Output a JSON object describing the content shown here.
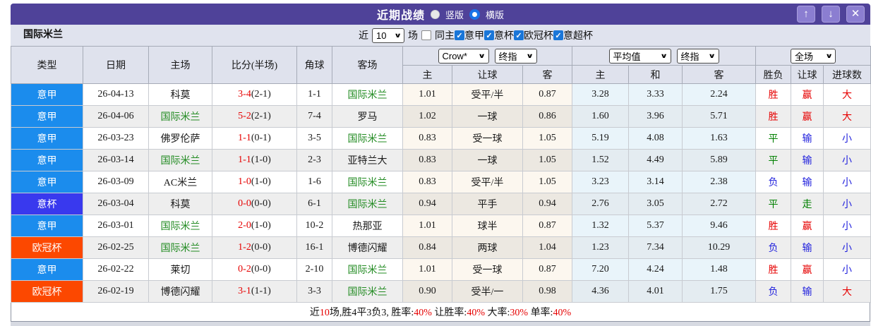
{
  "title_bar": {
    "title": "近期战绩",
    "vertical_label": "竖版",
    "horizontal_label": "横版",
    "up_icon": "↑",
    "down_icon": "↓",
    "close_icon": "✕"
  },
  "filter_bar": {
    "team": "国际米兰",
    "recent_label": "近",
    "recent_value": "10",
    "matches_label": "场",
    "same_host_label": "同主",
    "leagues": [
      {
        "label": "意甲",
        "checked": true
      },
      {
        "label": "意杯",
        "checked": true
      },
      {
        "label": "欧冠杯",
        "checked": true
      },
      {
        "label": "意超杯",
        "checked": true
      }
    ]
  },
  "table": {
    "headers": {
      "static": [
        "类型",
        "日期",
        "主场",
        "比分(半场)",
        "角球",
        "客场"
      ],
      "sub": [
        "主",
        "让球",
        "客",
        "主",
        "和",
        "客",
        "胜负",
        "让球",
        "进球数"
      ],
      "group1_select1": "Crow*",
      "group1_select2": "终指",
      "group2_select1": "平均值",
      "group2_select2": "终指",
      "group3_select1": "全场"
    },
    "rows": [
      {
        "league": "意甲",
        "league_class": "lg-seriea",
        "date": "26-04-13",
        "home": "科莫",
        "home_green": false,
        "score": "3-4",
        "half": "(2-1)",
        "corners": "1-1",
        "away": "国际米兰",
        "away_green": true,
        "crow_home": "1.01",
        "handicap": "受平/半",
        "crow_away": "0.87",
        "avg_home": "3.28",
        "avg_draw": "3.33",
        "avg_away": "2.24",
        "result": "胜",
        "result_class": "c-red",
        "handicap_result": "赢",
        "handicap_class": "c-red",
        "goals": "大",
        "goals_class": "c-red"
      },
      {
        "league": "意甲",
        "league_class": "lg-seriea",
        "date": "26-04-06",
        "home": "国际米兰",
        "home_green": true,
        "score": "5-2",
        "half": "(2-1)",
        "corners": "7-4",
        "away": "罗马",
        "away_green": false,
        "crow_home": "1.02",
        "handicap": "一球",
        "crow_away": "0.86",
        "avg_home": "1.60",
        "avg_draw": "3.96",
        "avg_away": "5.71",
        "result": "胜",
        "result_class": "c-red",
        "handicap_result": "赢",
        "handicap_class": "c-red",
        "goals": "大",
        "goals_class": "c-red"
      },
      {
        "league": "意甲",
        "league_class": "lg-seriea",
        "date": "26-03-23",
        "home": "佛罗伦萨",
        "home_green": false,
        "score": "1-1",
        "half": "(0-1)",
        "corners": "3-5",
        "away": "国际米兰",
        "away_green": true,
        "crow_home": "0.83",
        "handicap": "受一球",
        "crow_away": "1.05",
        "avg_home": "5.19",
        "avg_draw": "4.08",
        "avg_away": "1.63",
        "result": "平",
        "result_class": "c-green",
        "handicap_result": "输",
        "handicap_class": "c-blue",
        "goals": "小",
        "goals_class": "c-blue"
      },
      {
        "league": "意甲",
        "league_class": "lg-seriea",
        "date": "26-03-14",
        "home": "国际米兰",
        "home_green": true,
        "score": "1-1",
        "half": "(1-0)",
        "corners": "2-3",
        "away": "亚特兰大",
        "away_green": false,
        "crow_home": "0.83",
        "handicap": "一球",
        "crow_away": "1.05",
        "avg_home": "1.52",
        "avg_draw": "4.49",
        "avg_away": "5.89",
        "result": "平",
        "result_class": "c-green",
        "handicap_result": "输",
        "handicap_class": "c-blue",
        "goals": "小",
        "goals_class": "c-blue"
      },
      {
        "league": "意甲",
        "league_class": "lg-seriea",
        "date": "26-03-09",
        "home": "AC米兰",
        "home_green": false,
        "score": "1-0",
        "half": "(1-0)",
        "corners": "1-6",
        "away": "国际米兰",
        "away_green": true,
        "crow_home": "0.83",
        "handicap": "受平/半",
        "crow_away": "1.05",
        "avg_home": "3.23",
        "avg_draw": "3.14",
        "avg_away": "2.38",
        "result": "负",
        "result_class": "c-blue",
        "handicap_result": "输",
        "handicap_class": "c-blue",
        "goals": "小",
        "goals_class": "c-blue"
      },
      {
        "league": "意杯",
        "league_class": "lg-coppa",
        "date": "26-03-04",
        "home": "科莫",
        "home_green": false,
        "score": "0-0",
        "half": "(0-0)",
        "corners": "6-1",
        "away": "国际米兰",
        "away_green": true,
        "crow_home": "0.94",
        "handicap": "平手",
        "crow_away": "0.94",
        "avg_home": "2.76",
        "avg_draw": "3.05",
        "avg_away": "2.72",
        "result": "平",
        "result_class": "c-green",
        "handicap_result": "走",
        "handicap_class": "c-green",
        "goals": "小",
        "goals_class": "c-blue"
      },
      {
        "league": "意甲",
        "league_class": "lg-seriea",
        "date": "26-03-01",
        "home": "国际米兰",
        "home_green": true,
        "score": "2-0",
        "half": "(1-0)",
        "corners": "10-2",
        "away": "热那亚",
        "away_green": false,
        "crow_home": "1.01",
        "handicap": "球半",
        "crow_away": "0.87",
        "avg_home": "1.32",
        "avg_draw": "5.37",
        "avg_away": "9.46",
        "result": "胜",
        "result_class": "c-red",
        "handicap_result": "赢",
        "handicap_class": "c-red",
        "goals": "小",
        "goals_class": "c-blue"
      },
      {
        "league": "欧冠杯",
        "league_class": "lg-ucl",
        "date": "26-02-25",
        "home": "国际米兰",
        "home_green": true,
        "score": "1-2",
        "half": "(0-0)",
        "corners": "16-1",
        "away": "博德闪耀",
        "away_green": false,
        "crow_home": "0.84",
        "handicap": "两球",
        "crow_away": "1.04",
        "avg_home": "1.23",
        "avg_draw": "7.34",
        "avg_away": "10.29",
        "result": "负",
        "result_class": "c-blue",
        "handicap_result": "输",
        "handicap_class": "c-blue",
        "goals": "小",
        "goals_class": "c-blue"
      },
      {
        "league": "意甲",
        "league_class": "lg-seriea",
        "date": "26-02-22",
        "home": "莱切",
        "home_green": false,
        "score": "0-2",
        "half": "(0-0)",
        "corners": "2-10",
        "away": "国际米兰",
        "away_green": true,
        "crow_home": "1.01",
        "handicap": "受一球",
        "crow_away": "0.87",
        "avg_home": "7.20",
        "avg_draw": "4.24",
        "avg_away": "1.48",
        "result": "胜",
        "result_class": "c-red",
        "handicap_result": "赢",
        "handicap_class": "c-red",
        "goals": "小",
        "goals_class": "c-blue"
      },
      {
        "league": "欧冠杯",
        "league_class": "lg-ucl",
        "date": "26-02-19",
        "home": "博德闪耀",
        "home_green": false,
        "score": "3-1",
        "half": "(1-1)",
        "corners": "3-3",
        "away": "国际米兰",
        "away_green": true,
        "crow_home": "0.90",
        "handicap": "受半/一",
        "crow_away": "0.98",
        "avg_home": "4.36",
        "avg_draw": "4.01",
        "avg_away": "1.75",
        "result": "负",
        "result_class": "c-blue",
        "handicap_result": "输",
        "handicap_class": "c-blue",
        "goals": "大",
        "goals_class": "c-red"
      }
    ]
  },
  "footer": {
    "segments": [
      {
        "text": "近",
        "red": false
      },
      {
        "text": "10",
        "red": true
      },
      {
        "text": "场,胜4平3负3, 胜率:",
        "red": false
      },
      {
        "text": "40%",
        "red": true
      },
      {
        "text": " 让胜率:",
        "red": false
      },
      {
        "text": "40%",
        "red": true
      },
      {
        "text": " 大率:",
        "red": false
      },
      {
        "text": "30%",
        "red": true
      },
      {
        "text": " 单率:",
        "red": false
      },
      {
        "text": "40%",
        "red": true
      }
    ]
  },
  "colors": {
    "titlebar_purple": "#4f4299",
    "header_bg": "#dfe2ed",
    "serie_a_badge": "#1b8ced",
    "coppa_badge": "#3939ee",
    "ucl_badge": "#fc4800",
    "win_red": "#e60000",
    "draw_green": "#008000",
    "lose_blue": "#2323dd",
    "team_green": "#228B22",
    "crow_col_bg": "#fcf7ef",
    "avg_col_bg": "#e9f4fa"
  }
}
